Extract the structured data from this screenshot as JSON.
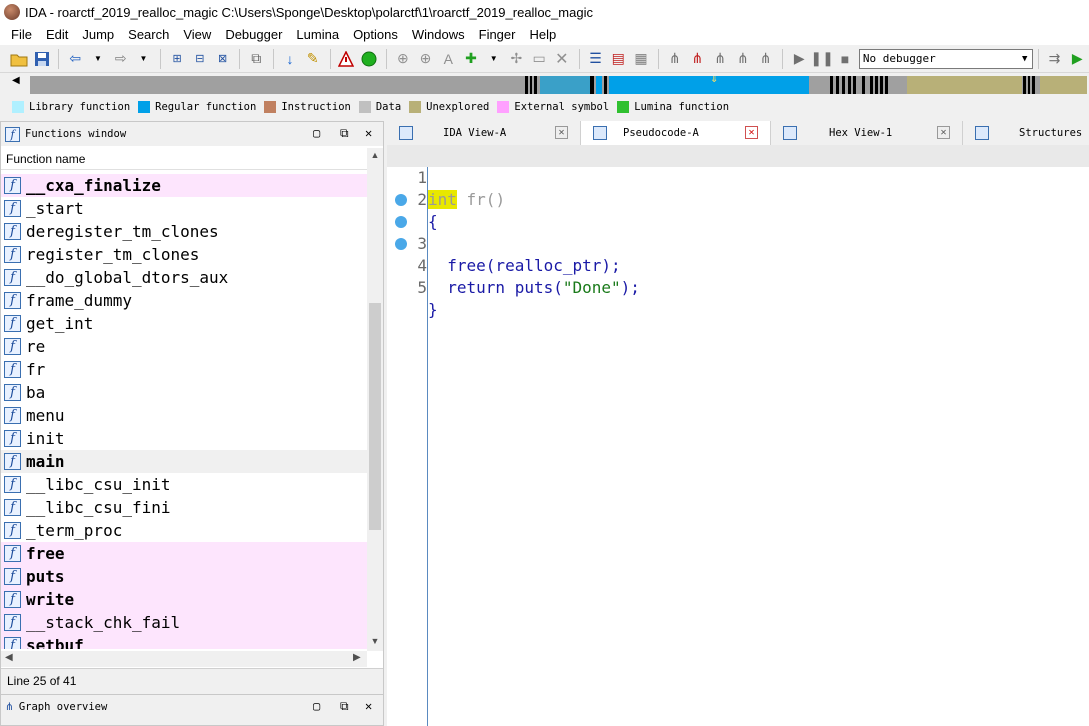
{
  "window": {
    "title": "IDA - roarctf_2019_realloc_magic C:\\Users\\Sponge\\Desktop\\polarctf\\1\\roarctf_2019_realloc_magic"
  },
  "menu": [
    "File",
    "Edit",
    "Jump",
    "Search",
    "View",
    "Debugger",
    "Lumina",
    "Options",
    "Windows",
    "Finger",
    "Help"
  ],
  "toolbar": {
    "debugger_select": "No debugger"
  },
  "legend": [
    {
      "label": "Library function",
      "color": "#b0f0ff"
    },
    {
      "label": "Regular function",
      "color": "#00a0e8"
    },
    {
      "label": "Instruction",
      "color": "#c08060"
    },
    {
      "label": "Data",
      "color": "#c0c0c0"
    },
    {
      "label": "Unexplored",
      "color": "#b8b078"
    },
    {
      "label": "External symbol",
      "color": "#ffa0ff"
    },
    {
      "label": "Lumina function",
      "color": "#30c030"
    }
  ],
  "functions_window": {
    "title": "Functions window",
    "column_header": "Function name",
    "items": [
      {
        "name": "__cxa_finalize",
        "bold": true,
        "pink": true
      },
      {
        "name": "_start",
        "bold": false,
        "pink": false
      },
      {
        "name": "deregister_tm_clones",
        "bold": false,
        "pink": false
      },
      {
        "name": "register_tm_clones",
        "bold": false,
        "pink": false
      },
      {
        "name": "__do_global_dtors_aux",
        "bold": false,
        "pink": false
      },
      {
        "name": "frame_dummy",
        "bold": false,
        "pink": false
      },
      {
        "name": "get_int",
        "bold": false,
        "pink": false
      },
      {
        "name": "re",
        "bold": false,
        "pink": false
      },
      {
        "name": "fr",
        "bold": false,
        "pink": false
      },
      {
        "name": "ba",
        "bold": false,
        "pink": false
      },
      {
        "name": "menu",
        "bold": false,
        "pink": false
      },
      {
        "name": "init",
        "bold": false,
        "pink": false
      },
      {
        "name": "main",
        "bold": true,
        "pink": false,
        "selected": true
      },
      {
        "name": "__libc_csu_init",
        "bold": false,
        "pink": false
      },
      {
        "name": "__libc_csu_fini",
        "bold": false,
        "pink": false
      },
      {
        "name": "_term_proc",
        "bold": false,
        "pink": false
      },
      {
        "name": "free",
        "bold": true,
        "pink": true
      },
      {
        "name": "puts",
        "bold": true,
        "pink": true
      },
      {
        "name": "write",
        "bold": true,
        "pink": true
      },
      {
        "name": "__stack_chk_fail",
        "bold": false,
        "pink": true
      },
      {
        "name": "setbuf",
        "bold": true,
        "pink": true
      }
    ],
    "status": "Line 25 of 41"
  },
  "graph_overview": {
    "title": "Graph overview"
  },
  "tabs": [
    {
      "label": "IDA View-A",
      "active": false
    },
    {
      "label": "Pseudocode-A",
      "active": true
    },
    {
      "label": "Hex View-1",
      "active": false
    },
    {
      "label": "Structures",
      "active": false
    }
  ],
  "pseudocode": {
    "lines": [
      {
        "num": "1",
        "breakpoint": false
      },
      {
        "num": "2",
        "breakpoint": false
      },
      {
        "num": "3",
        "breakpoint": true
      },
      {
        "num": "4",
        "breakpoint": true
      },
      {
        "num": "5",
        "breakpoint": true
      }
    ],
    "l1_kw": "int",
    "l1_rest": " fr()",
    "l2": "{",
    "l3_fn": "  free(realloc_ptr);",
    "l4_a": "  return puts(",
    "l4_str": "\"Done\"",
    "l4_b": ");",
    "l5": "}"
  }
}
